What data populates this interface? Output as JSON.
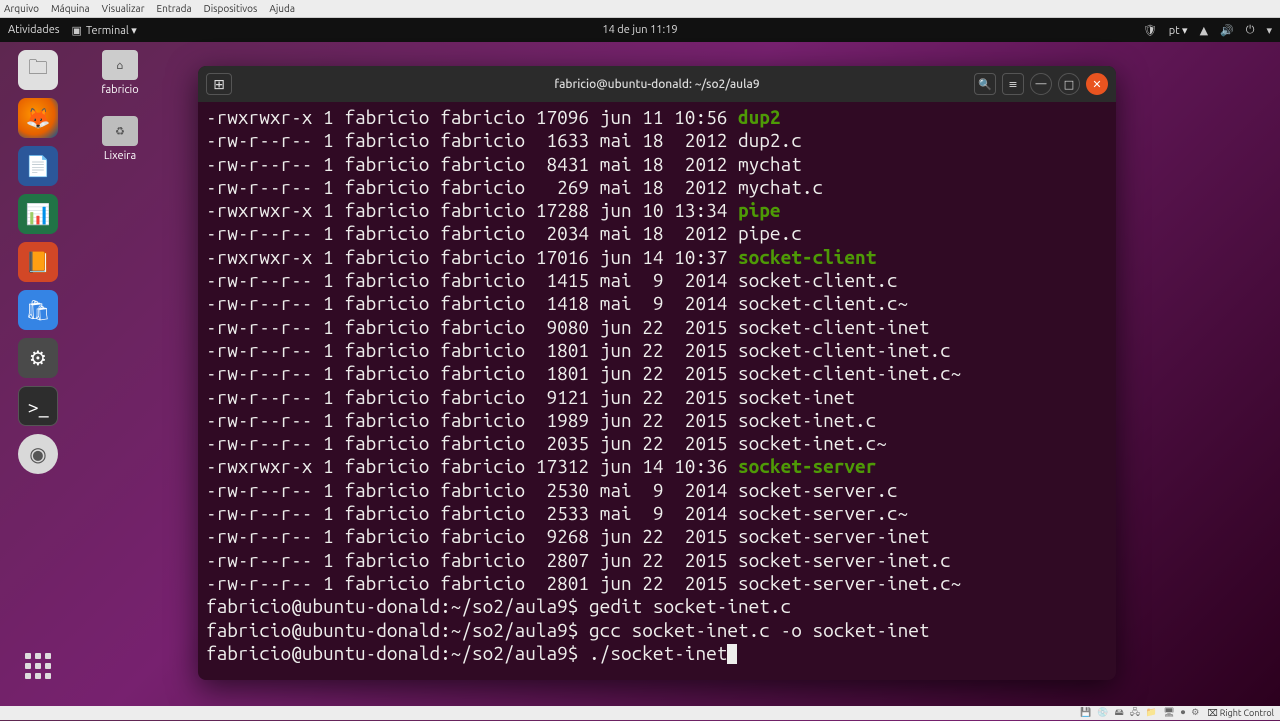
{
  "vm_menu": {
    "items": [
      "Arquivo",
      "Máquina",
      "Visualizar",
      "Entrada",
      "Dispositivos",
      "Ajuda"
    ]
  },
  "topbar": {
    "activities": "Atividades",
    "app_indicator": "Terminal ▾",
    "clock": "14 de jun  11:19",
    "lang": "pt ▾"
  },
  "desktop_icons": {
    "home": "fabricio",
    "trash": "Lixeira"
  },
  "terminal": {
    "title": "fabricio@ubuntu-donald: ~/so2/aula9",
    "prompt_user_host": "fabricio@ubuntu-donald",
    "prompt_path": "~/so2/aula9",
    "history": [
      {
        "cmd": "gedit socket-inet.c"
      },
      {
        "cmd": "gcc socket-inet.c -o socket-inet"
      }
    ],
    "current_cmd": "./socket-inet",
    "listing": [
      {
        "perm": "-rwxrwxr-x",
        "links": "1",
        "owner": "fabricio",
        "group": "fabricio",
        "size": "17096",
        "month": "jun",
        "day": "11",
        "time": "10:56",
        "name": "dup2",
        "exe": true
      },
      {
        "perm": "-rw-r--r--",
        "links": "1",
        "owner": "fabricio",
        "group": "fabricio",
        "size": " 1633",
        "month": "mai",
        "day": "18",
        "time": " 2012",
        "name": "dup2.c"
      },
      {
        "perm": "-rw-r--r--",
        "links": "1",
        "owner": "fabricio",
        "group": "fabricio",
        "size": " 8431",
        "month": "mai",
        "day": "18",
        "time": " 2012",
        "name": "mychat"
      },
      {
        "perm": "-rw-r--r--",
        "links": "1",
        "owner": "fabricio",
        "group": "fabricio",
        "size": "  269",
        "month": "mai",
        "day": "18",
        "time": " 2012",
        "name": "mychat.c"
      },
      {
        "perm": "-rwxrwxr-x",
        "links": "1",
        "owner": "fabricio",
        "group": "fabricio",
        "size": "17288",
        "month": "jun",
        "day": "10",
        "time": "13:34",
        "name": "pipe",
        "exe": true
      },
      {
        "perm": "-rw-r--r--",
        "links": "1",
        "owner": "fabricio",
        "group": "fabricio",
        "size": " 2034",
        "month": "mai",
        "day": "18",
        "time": " 2012",
        "name": "pipe.c"
      },
      {
        "perm": "-rwxrwxr-x",
        "links": "1",
        "owner": "fabricio",
        "group": "fabricio",
        "size": "17016",
        "month": "jun",
        "day": "14",
        "time": "10:37",
        "name": "socket-client",
        "exe": true
      },
      {
        "perm": "-rw-r--r--",
        "links": "1",
        "owner": "fabricio",
        "group": "fabricio",
        "size": " 1415",
        "month": "mai",
        "day": " 9",
        "time": " 2014",
        "name": "socket-client.c"
      },
      {
        "perm": "-rw-r--r--",
        "links": "1",
        "owner": "fabricio",
        "group": "fabricio",
        "size": " 1418",
        "month": "mai",
        "day": " 9",
        "time": " 2014",
        "name": "socket-client.c~"
      },
      {
        "perm": "-rw-r--r--",
        "links": "1",
        "owner": "fabricio",
        "group": "fabricio",
        "size": " 9080",
        "month": "jun",
        "day": "22",
        "time": " 2015",
        "name": "socket-client-inet"
      },
      {
        "perm": "-rw-r--r--",
        "links": "1",
        "owner": "fabricio",
        "group": "fabricio",
        "size": " 1801",
        "month": "jun",
        "day": "22",
        "time": " 2015",
        "name": "socket-client-inet.c"
      },
      {
        "perm": "-rw-r--r--",
        "links": "1",
        "owner": "fabricio",
        "group": "fabricio",
        "size": " 1801",
        "month": "jun",
        "day": "22",
        "time": " 2015",
        "name": "socket-client-inet.c~"
      },
      {
        "perm": "-rw-r--r--",
        "links": "1",
        "owner": "fabricio",
        "group": "fabricio",
        "size": " 9121",
        "month": "jun",
        "day": "22",
        "time": " 2015",
        "name": "socket-inet"
      },
      {
        "perm": "-rw-r--r--",
        "links": "1",
        "owner": "fabricio",
        "group": "fabricio",
        "size": " 1989",
        "month": "jun",
        "day": "22",
        "time": " 2015",
        "name": "socket-inet.c"
      },
      {
        "perm": "-rw-r--r--",
        "links": "1",
        "owner": "fabricio",
        "group": "fabricio",
        "size": " 2035",
        "month": "jun",
        "day": "22",
        "time": " 2015",
        "name": "socket-inet.c~"
      },
      {
        "perm": "-rwxrwxr-x",
        "links": "1",
        "owner": "fabricio",
        "group": "fabricio",
        "size": "17312",
        "month": "jun",
        "day": "14",
        "time": "10:36",
        "name": "socket-server",
        "exe": true
      },
      {
        "perm": "-rw-r--r--",
        "links": "1",
        "owner": "fabricio",
        "group": "fabricio",
        "size": " 2530",
        "month": "mai",
        "day": " 9",
        "time": " 2014",
        "name": "socket-server.c"
      },
      {
        "perm": "-rw-r--r--",
        "links": "1",
        "owner": "fabricio",
        "group": "fabricio",
        "size": " 2533",
        "month": "mai",
        "day": " 9",
        "time": " 2014",
        "name": "socket-server.c~"
      },
      {
        "perm": "-rw-r--r--",
        "links": "1",
        "owner": "fabricio",
        "group": "fabricio",
        "size": " 9268",
        "month": "jun",
        "day": "22",
        "time": " 2015",
        "name": "socket-server-inet"
      },
      {
        "perm": "-rw-r--r--",
        "links": "1",
        "owner": "fabricio",
        "group": "fabricio",
        "size": " 2807",
        "month": "jun",
        "day": "22",
        "time": " 2015",
        "name": "socket-server-inet.c"
      },
      {
        "perm": "-rw-r--r--",
        "links": "1",
        "owner": "fabricio",
        "group": "fabricio",
        "size": " 2801",
        "month": "jun",
        "day": "22",
        "time": " 2015",
        "name": "socket-server-inet.c~"
      }
    ]
  },
  "vm_status": {
    "host_key": "Right Control"
  }
}
